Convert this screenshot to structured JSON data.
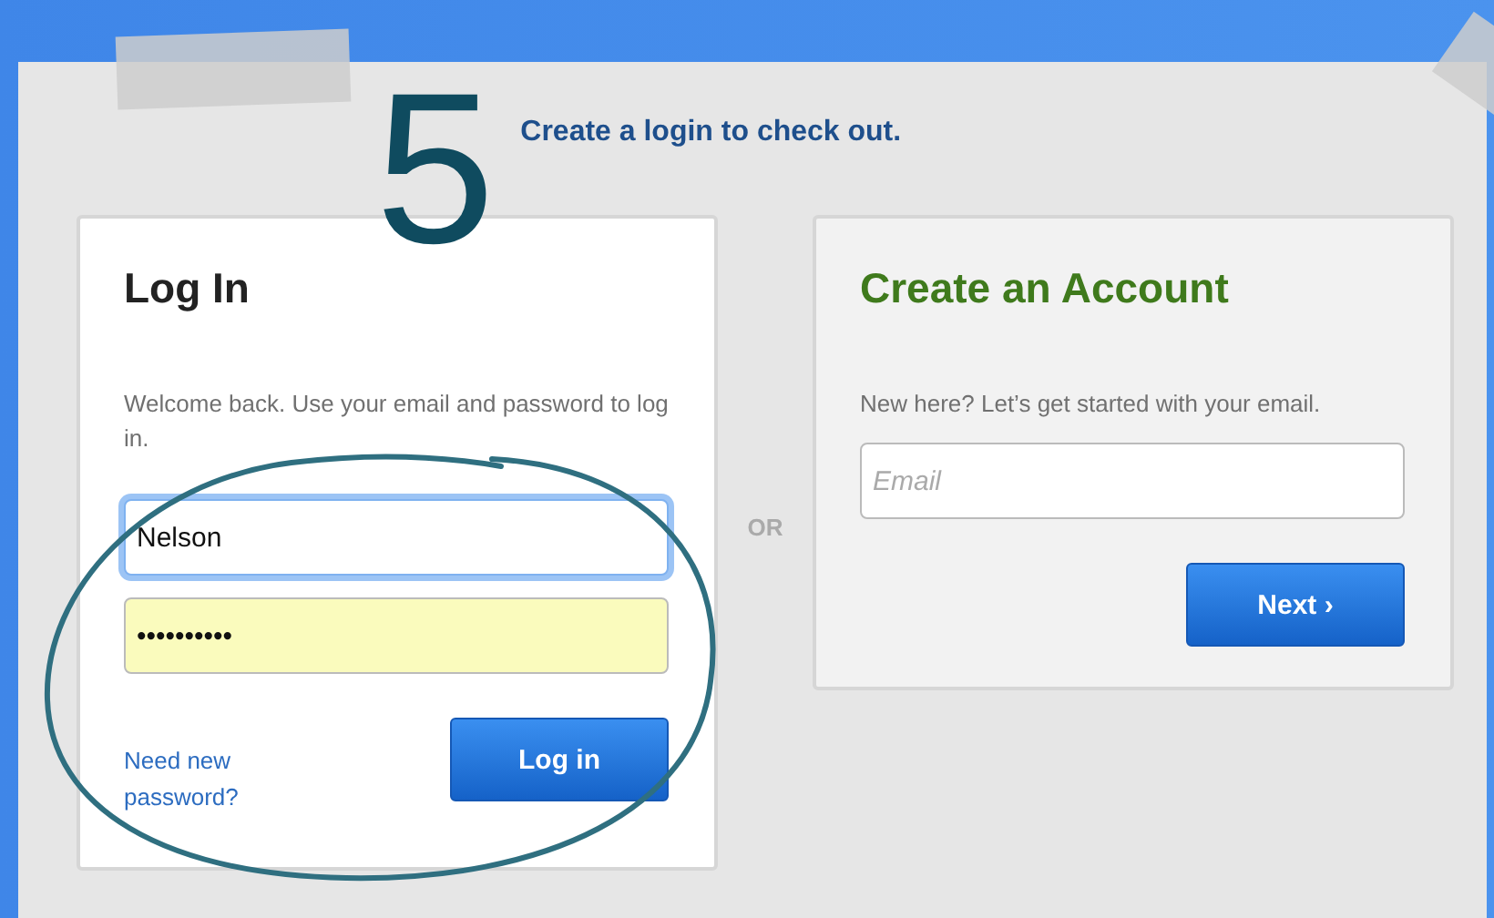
{
  "step_number": "5",
  "heading": "Create a login to check out.",
  "login": {
    "title": "Log In",
    "description": "Welcome back. Use your email and password to log in.",
    "username": {
      "value": "Nelson",
      "focused": true
    },
    "password": {
      "value": "••••••••••",
      "autofilled": true
    },
    "forgot_link": "Need new password?",
    "button": "Log in"
  },
  "separator": "OR",
  "create_account": {
    "title": "Create an Account",
    "description": "New here? Let’s get started with your email.",
    "email": {
      "placeholder": "Email"
    },
    "button": "Next ›"
  }
}
